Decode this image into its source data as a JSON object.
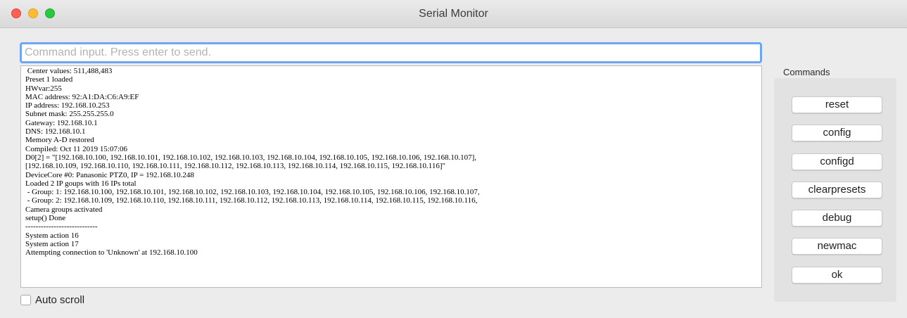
{
  "window": {
    "title": "Serial Monitor"
  },
  "command_input": {
    "placeholder": "Command input. Press enter to send.",
    "value": ""
  },
  "output_lines": [
    " Center values: 511,488,483",
    "Preset 1 loaded",
    "HWvar:255",
    "MAC address: 92:A1:DA:C6:A9:EF",
    "IP address: 192.168.10.253",
    "Subnet mask: 255.255.255.0",
    "Gateway: 192.168.10.1",
    "DNS: 192.168.10.1",
    "Memory A-D restored",
    "Compiled: Oct 11 2019 15:07:06",
    "D0[2] = \"[192.168.10.100, 192.168.10.101, 192.168.10.102, 192.168.10.103, 192.168.10.104, 192.168.10.105, 192.168.10.106, 192.168.10.107],",
    "[192.168.10.109, 192.168.10.110, 192.168.10.111, 192.168.10.112, 192.168.10.113, 192.168.10.114, 192.168.10.115, 192.168.10.116]\"",
    "DeviceCore #0: Panasonic PTZ0, IP = 192.168.10.248",
    "Loaded 2 IP goups with 16 IPs total",
    " - Group: 1: 192.168.10.100, 192.168.10.101, 192.168.10.102, 192.168.10.103, 192.168.10.104, 192.168.10.105, 192.168.10.106, 192.168.10.107,",
    " - Group: 2: 192.168.10.109, 192.168.10.110, 192.168.10.111, 192.168.10.112, 192.168.10.113, 192.168.10.114, 192.168.10.115, 192.168.10.116,",
    "Camera groups activated",
    "setup() Done",
    "----------------------------",
    "System action 16",
    "System action 17",
    "Attempting connection to 'Unknown' at 192.168.10.100"
  ],
  "auto_scroll": {
    "label": "Auto scroll",
    "checked": false
  },
  "commands": {
    "title": "Commands",
    "buttons": [
      "reset",
      "config",
      "configd",
      "clearpresets",
      "debug",
      "newmac",
      "ok"
    ]
  },
  "colors": {
    "close": "#fe5f57",
    "minimize": "#febc2e",
    "maximize": "#28c840",
    "focus_ring": "#6ea6f5"
  }
}
